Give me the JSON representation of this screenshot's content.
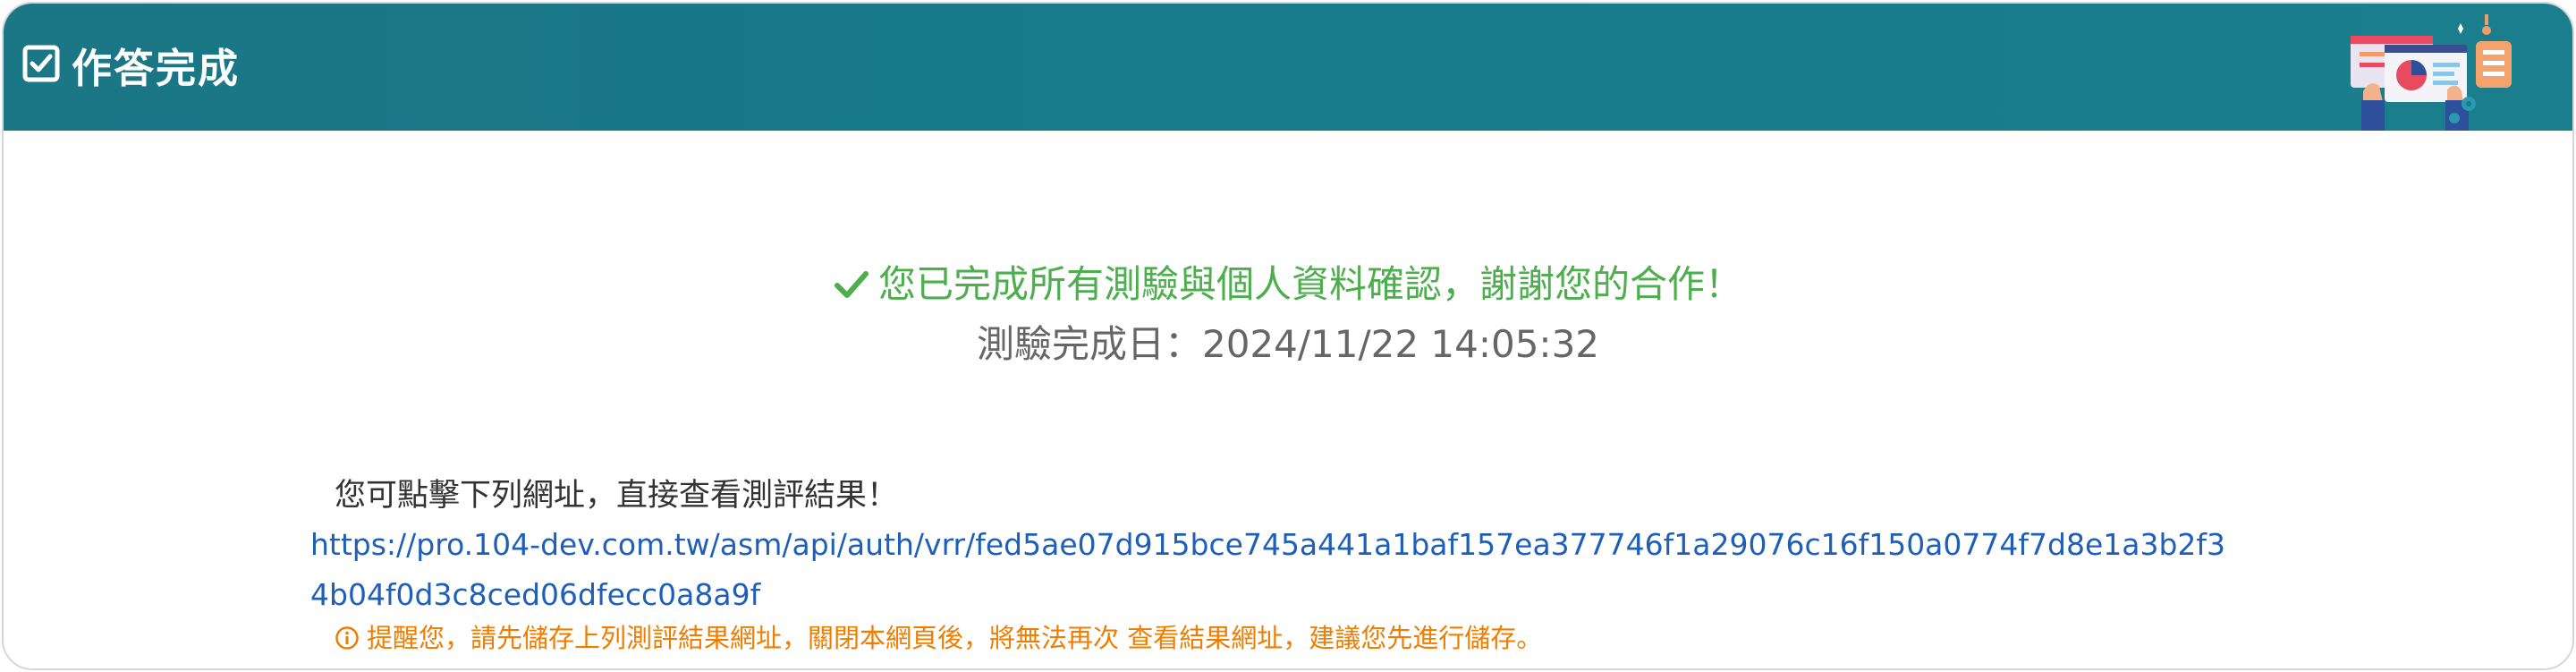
{
  "header": {
    "title": "作答完成",
    "icon": "check-square-icon",
    "illustration": "analytics-dashboard-illustration"
  },
  "completion": {
    "message": "您已完成所有測驗與個人資料確認，謝謝您的合作！",
    "date_label": "測驗完成日：",
    "date_value": "2024/11/22 14:05:32"
  },
  "result": {
    "intro": "您可點擊下列網址，直接查看測評結果！",
    "url": "https://pro.104-dev.com.tw/asm/api/auth/vrr/fed5ae07d915bce745a441a1baf157ea377746f1a29076c16f150a0774f7d8e1a3b2f34b04f0d3c8ced06dfecc0a8a9f",
    "warning": "提醒您，請先儲存上列測評結果網址，關閉本網頁後，將無法再次 查看結果網址，建議您先進行儲存。"
  },
  "colors": {
    "header_bg": "#177b8b",
    "success": "#4cae4c",
    "link": "#1f5fb8",
    "warning": "#ef7d00"
  }
}
